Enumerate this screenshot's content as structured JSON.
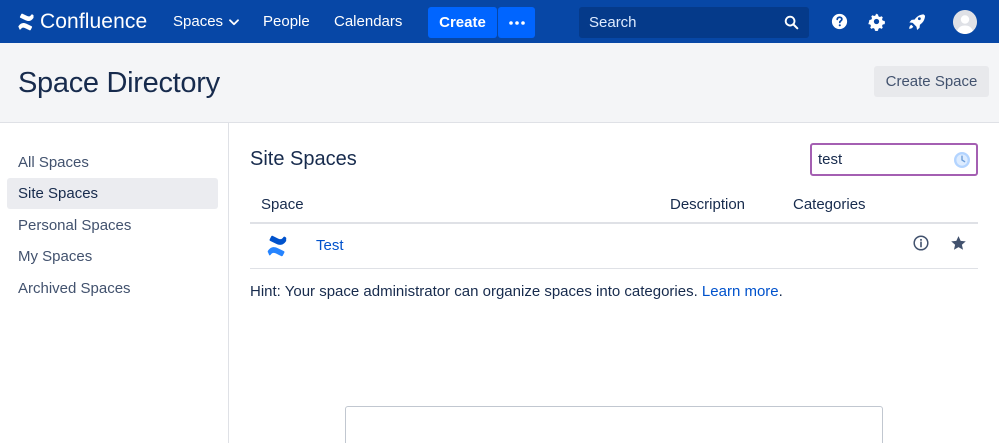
{
  "nav": {
    "app_name": "Confluence",
    "spaces": "Spaces",
    "people": "People",
    "calendars": "Calendars",
    "create": "Create",
    "search_placeholder": "Search"
  },
  "header": {
    "title": "Space Directory",
    "create_space": "Create Space"
  },
  "sidebar": {
    "items": [
      {
        "label": "All Spaces",
        "active": false
      },
      {
        "label": "Site Spaces",
        "active": true
      },
      {
        "label": "Personal Spaces",
        "active": false
      },
      {
        "label": "My Spaces",
        "active": false
      },
      {
        "label": "Archived Spaces",
        "active": false
      }
    ]
  },
  "main": {
    "title": "Site Spaces",
    "filter_value": "test",
    "columns": [
      "Space",
      "Description",
      "Categories"
    ],
    "rows": [
      {
        "name": "Test",
        "description": "",
        "categories": ""
      }
    ],
    "hint_text": "Hint: Your space administrator can organize spaces into categories. ",
    "hint_link": "Learn more",
    "hint_end": "."
  },
  "colors": {
    "nav_bg": "#0747a6",
    "accent": "#0065ff",
    "link": "#0052cc",
    "focus_ring": "#a45fb2"
  },
  "icons": {
    "logo": "confluence-logo-icon",
    "spaces_menu": "chevron-down-icon",
    "more": "more-dots-icon",
    "search": "search-icon",
    "help": "help-icon",
    "settings": "gear-icon",
    "notifications": "rocket-icon",
    "profile": "avatar-icon",
    "filter_history": "clock-icon",
    "info": "info-icon",
    "favourite": "star-icon"
  }
}
